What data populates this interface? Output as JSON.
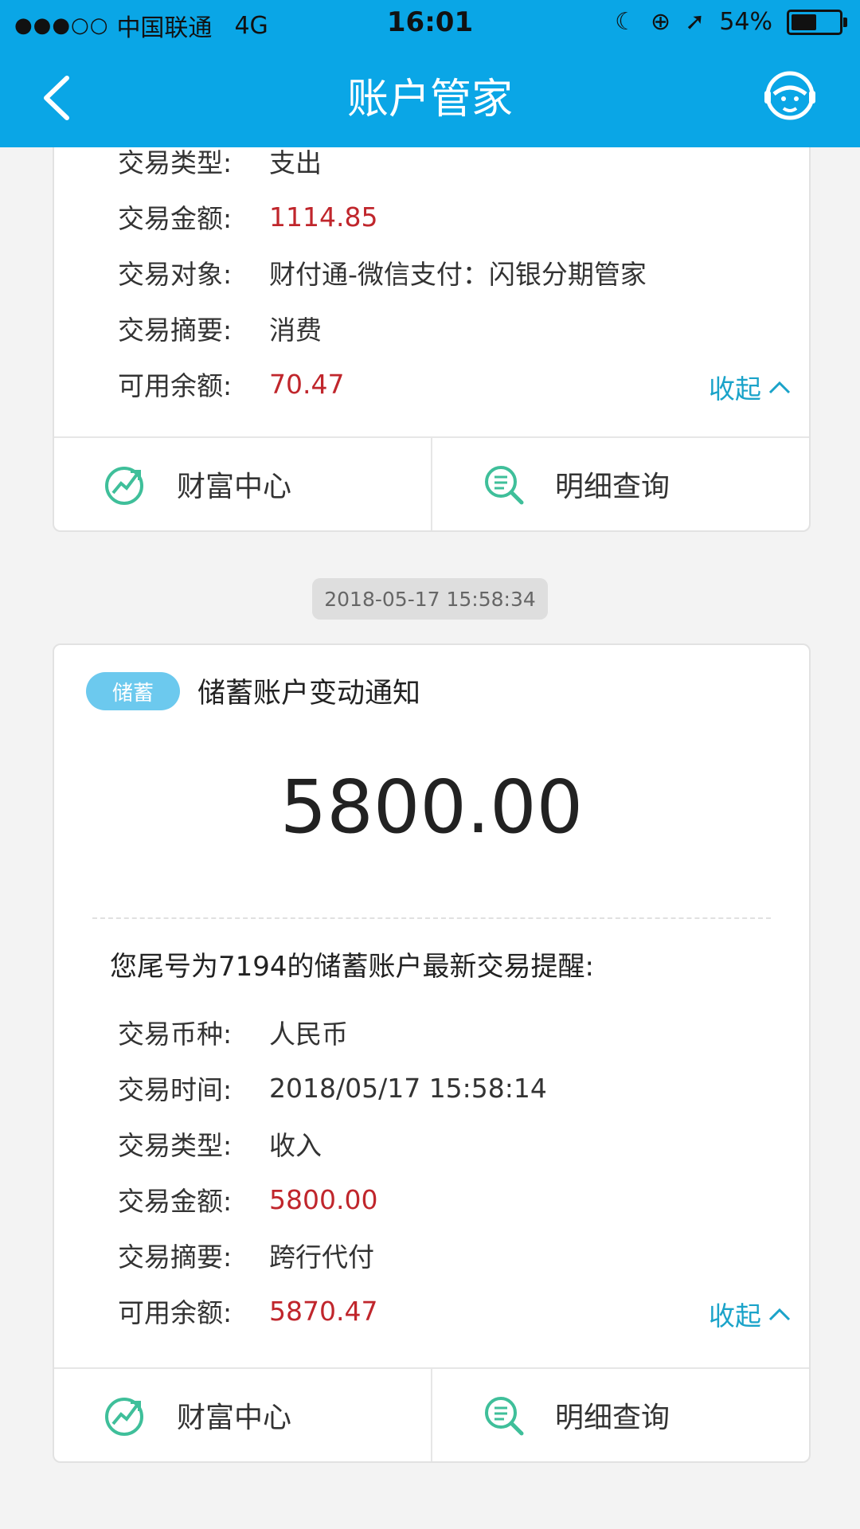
{
  "status_bar": {
    "carrier": "中国联通",
    "network": "4G",
    "time": "16:01",
    "battery": "54%",
    "battery_level": 0.54
  },
  "nav": {
    "title": "账户管家"
  },
  "card1": {
    "rows": [
      {
        "label": "交易类型:",
        "value": "支出"
      },
      {
        "label": "交易金额:",
        "value": "1114.85"
      },
      {
        "label": "交易对象:",
        "value": "财付通-微信支付：闪银分期管家"
      },
      {
        "label": "交易摘要:",
        "value": "消费"
      },
      {
        "label": "可用余额:",
        "value": "70.47"
      }
    ],
    "collapse_label": "收起",
    "wealth_label": "财富中心",
    "detail_label": "明细查询"
  },
  "timestamp": "2018-05-17 15:58:34",
  "card2": {
    "tag": "储蓄",
    "title": "储蓄账户变动通知",
    "amount": "5800.00",
    "description": "您尾号为7194的储蓄账户最新交易提醒:",
    "rows": [
      {
        "label": "交易币种:",
        "value": "人民币"
      },
      {
        "label": "交易时间:",
        "value": "2018/05/17 15:58:14"
      },
      {
        "label": "交易类型:",
        "value": "收入"
      },
      {
        "label": "交易金额:",
        "value": "5800.00"
      },
      {
        "label": "交易摘要:",
        "value": "跨行代付"
      },
      {
        "label": "可用余额:",
        "value": "5870.47"
      }
    ],
    "collapse_label": "收起",
    "wealth_label": "财富中心",
    "detail_label": "明细查询"
  },
  "colors": {
    "header": "#0aa6e6",
    "accent": "#1aa3c9",
    "amount_red": "#c0262c"
  }
}
